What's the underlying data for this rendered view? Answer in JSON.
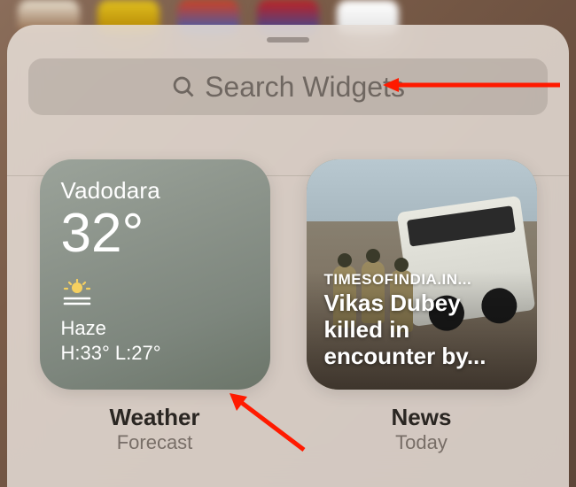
{
  "search": {
    "placeholder": "Search Widgets"
  },
  "widgets": [
    {
      "type": "weather",
      "location": "Vadodara",
      "temperature": "32°",
      "condition": "Haze",
      "high": "H:33°",
      "low": "L:27°",
      "title": "Weather",
      "subtitle": "Forecast"
    },
    {
      "type": "news",
      "source": "TIMESOFINDIA.IN...",
      "headline": "Vikas Dubey killed in encounter by...",
      "title": "News",
      "subtitle": "Today"
    }
  ],
  "colors": {
    "arrow": "#ff1a00"
  }
}
